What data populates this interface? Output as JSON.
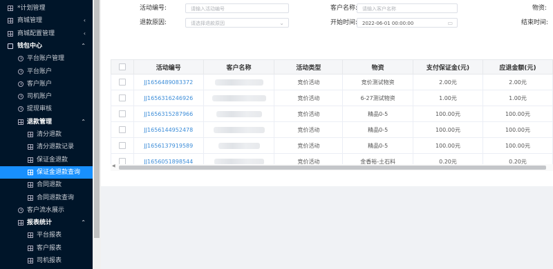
{
  "sidebar": {
    "items": [
      {
        "label": "*计划管理",
        "level": 0,
        "icon": "grid-icon",
        "chevron": "",
        "top": false
      },
      {
        "label": "商城管理",
        "level": 0,
        "icon": "grid-icon",
        "chevron": "‹",
        "top": false
      },
      {
        "label": "商城配置管理",
        "level": 0,
        "icon": "grid-icon",
        "chevron": "‹",
        "top": false
      },
      {
        "label": "钱包中心",
        "level": 0,
        "icon": "wallet-icon",
        "chevron": "⌃",
        "top": true
      },
      {
        "label": "平台账户管理",
        "level": 1,
        "icon": "clock-icon",
        "chevron": "",
        "top": false
      },
      {
        "label": "平台账户",
        "level": 1,
        "icon": "clock-icon",
        "chevron": "",
        "top": false
      },
      {
        "label": "客户账户",
        "level": 1,
        "icon": "clock-icon",
        "chevron": "",
        "top": false
      },
      {
        "label": "司机账户",
        "level": 1,
        "icon": "clock-icon",
        "chevron": "",
        "top": false
      },
      {
        "label": "提现审核",
        "level": 1,
        "icon": "clock-icon",
        "chevron": "",
        "top": false
      },
      {
        "label": "退款管理",
        "level": 1,
        "icon": "grid-icon",
        "chevron": "⌃",
        "top": true
      },
      {
        "label": "清分退款",
        "level": 2,
        "icon": "grid-icon",
        "chevron": "",
        "top": false
      },
      {
        "label": "清分退款记录",
        "level": 2,
        "icon": "grid-icon",
        "chevron": "",
        "top": false
      },
      {
        "label": "保证金退款",
        "level": 2,
        "icon": "grid-icon",
        "chevron": "",
        "top": false
      },
      {
        "label": "保证金退款查询",
        "level": 2,
        "icon": "grid-icon",
        "chevron": "",
        "top": false,
        "active": true
      },
      {
        "label": "合同退款",
        "level": 2,
        "icon": "grid-icon",
        "chevron": "",
        "top": false
      },
      {
        "label": "合同退款查询",
        "level": 2,
        "icon": "grid-icon",
        "chevron": "",
        "top": false
      },
      {
        "label": "客户流水展示",
        "level": 1,
        "icon": "clock-icon",
        "chevron": "",
        "top": false
      },
      {
        "label": "报表统计",
        "level": 1,
        "icon": "grid-icon",
        "chevron": "⌃",
        "top": true
      },
      {
        "label": "平台报表",
        "level": 2,
        "icon": "grid-icon",
        "chevron": "",
        "top": false
      },
      {
        "label": "客户报表",
        "level": 2,
        "icon": "grid-icon",
        "chevron": "",
        "top": false
      },
      {
        "label": "司机报表",
        "level": 2,
        "icon": "grid-icon",
        "chevron": "",
        "top": false
      }
    ]
  },
  "filters": {
    "activity_no_label": "活动编号:",
    "activity_no_placeholder": "请输入活动编号",
    "customer_label": "客户名称:",
    "customer_placeholder": "请输入客户名称",
    "material_label": "物资:",
    "reason_label": "退款原因:",
    "reason_placeholder": "请选择退款原因",
    "start_label": "开始时间:",
    "start_value": "2022-06-01 00:00:00",
    "end_label": "结束时间:"
  },
  "table": {
    "headers": [
      "活动编号",
      "客户名称",
      "活动类型",
      "物资",
      "支付保证金(元)",
      "应退金额(元)"
    ],
    "rows": [
      [
        "JJ1656489083372",
        "",
        "竞价活动",
        "竞价测试物资",
        "2.00元",
        "2.00元"
      ],
      [
        "JJ1656316246926",
        "",
        "竞价活动",
        "6-27测试物资",
        "1.00元",
        "1.00元"
      ],
      [
        "JJ1656315287966",
        "",
        "竞价活动",
        "精品0-5",
        "100.00元",
        "100.00元"
      ],
      [
        "JJ1656144952478",
        "",
        "竞价活动",
        "精品0-5",
        "100.00元",
        "100.00元"
      ],
      [
        "JJ1656137919589",
        "",
        "竞价活动",
        "精品0-5",
        "100.00元",
        "100.00元"
      ],
      [
        "JJ1656051898544",
        "",
        "竞价活动",
        "金香裕-土石料",
        "0.20元",
        "0.20元"
      ]
    ]
  },
  "colors": {
    "sidebar_bg": "#001529",
    "active": "#1890ff",
    "link": "#3b8cd8"
  }
}
